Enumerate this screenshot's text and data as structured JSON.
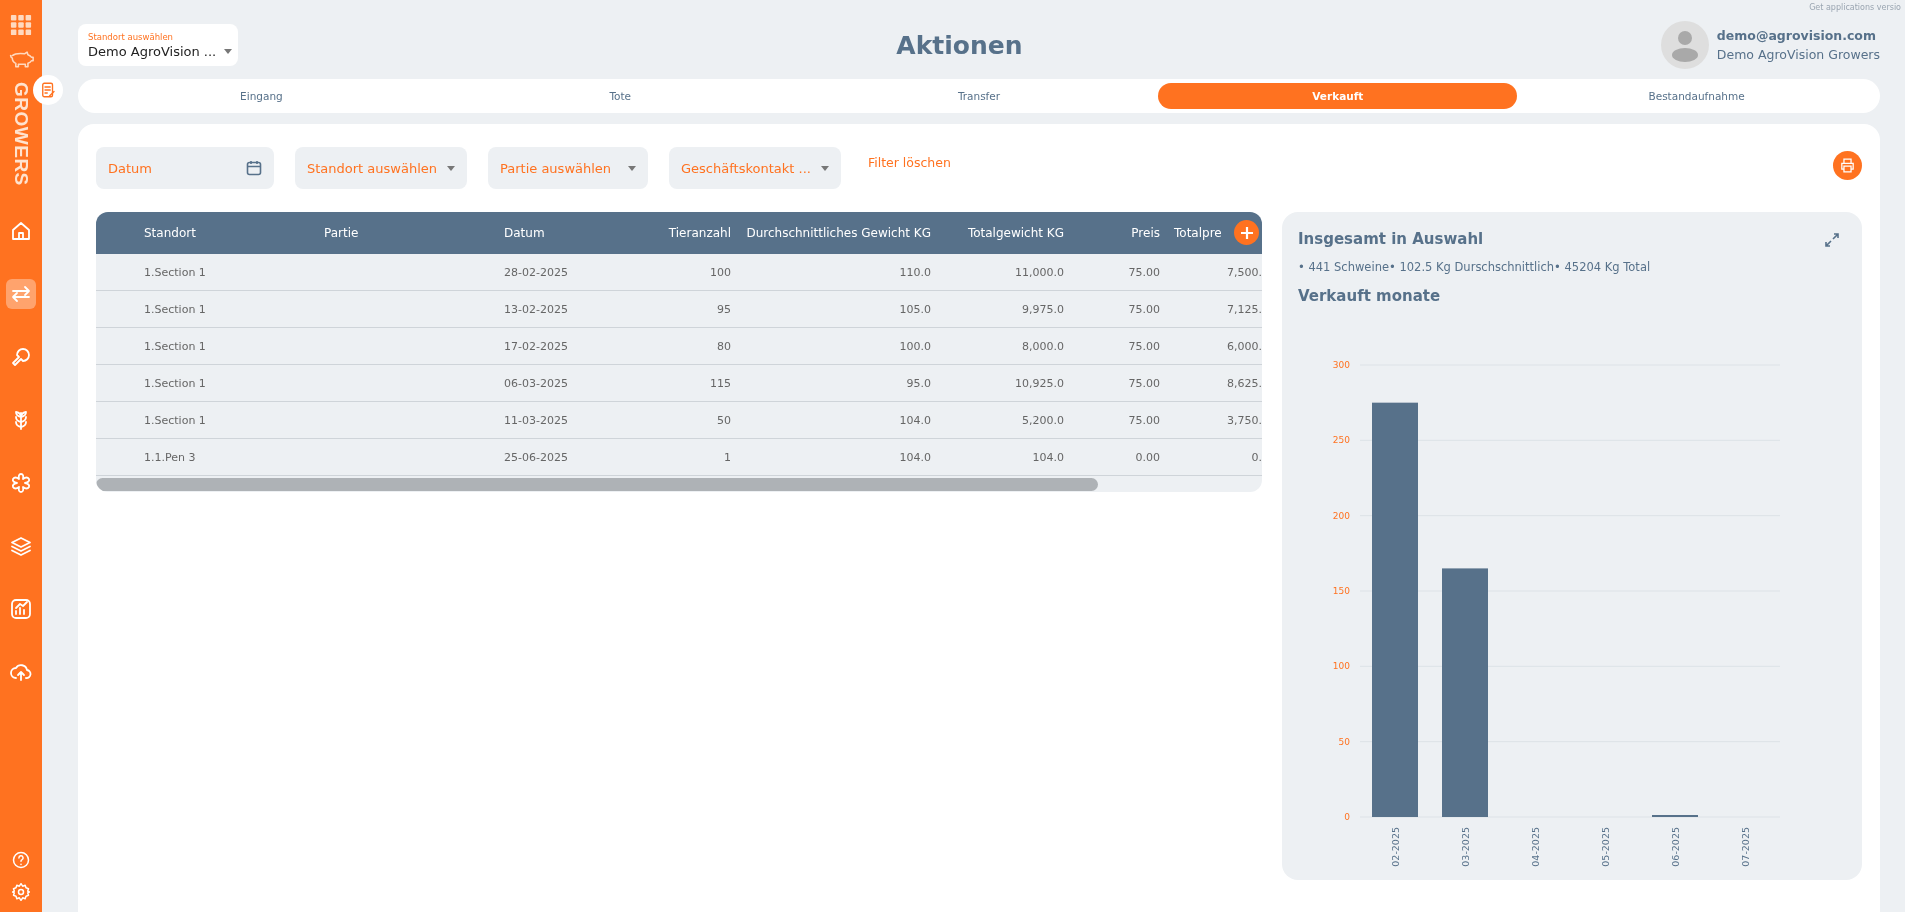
{
  "sidebar": {
    "brand": "GROWERS",
    "items": [
      {
        "selected": false
      },
      {
        "selected": true
      },
      {
        "selected": false
      },
      {
        "selected": false
      },
      {
        "selected": false
      },
      {
        "selected": false
      },
      {
        "selected": false
      },
      {
        "selected": false
      }
    ]
  },
  "location_select": {
    "label": "Standort auswählen",
    "value": "Demo AgroVision ..."
  },
  "page_title": "Aktionen",
  "user": {
    "email": "demo@agrovision.com",
    "company": "Demo AgroVision Growers"
  },
  "version_note": "Get applications versio",
  "tabs": [
    {
      "label": "Eingang",
      "selected": false
    },
    {
      "label": "Tote",
      "selected": false
    },
    {
      "label": "Transfer",
      "selected": false
    },
    {
      "label": "Verkauft",
      "selected": true
    },
    {
      "label": "Bestandaufnahme",
      "selected": false
    }
  ],
  "filters": [
    {
      "kind": "date",
      "label": "Datum"
    },
    {
      "kind": "select",
      "label": "Standort auswählen"
    },
    {
      "kind": "select",
      "label": "Partie auswählen"
    },
    {
      "kind": "select",
      "label": "Geschäftskontakt ..."
    }
  ],
  "clear_filters": "Filter löschen",
  "table": {
    "columns": [
      "Standort",
      "Partie",
      "Datum",
      "Tieranzahl",
      "Durchschnittliches Gewicht KG",
      "Totalgewicht KG",
      "Preis",
      "Totalpre"
    ],
    "rows": [
      [
        "1.Section 1",
        "",
        "28-02-2025",
        "100",
        "110.0",
        "11,000.0",
        "75.00",
        "7,500."
      ],
      [
        "1.Section 1",
        "",
        "13-02-2025",
        "95",
        "105.0",
        "9,975.0",
        "75.00",
        "7,125."
      ],
      [
        "1.Section 1",
        "",
        "17-02-2025",
        "80",
        "100.0",
        "8,000.0",
        "75.00",
        "6,000."
      ],
      [
        "1.Section 1",
        "",
        "06-03-2025",
        "115",
        "95.0",
        "10,925.0",
        "75.00",
        "8,625."
      ],
      [
        "1.Section 1",
        "",
        "11-03-2025",
        "50",
        "104.0",
        "5,200.0",
        "75.00",
        "3,750."
      ],
      [
        "1.1.Pen 3",
        "",
        "25-06-2025",
        "1",
        "104.0",
        "104.0",
        "0.00",
        "0."
      ]
    ]
  },
  "summary": {
    "title": "Insgesamt in Auswahl",
    "stats": "• 441 Schweine• 102.5 Kg Durschschnittlich• 45204 Kg Total",
    "chart_title": "Verkauft monate",
    "chart_data": {
      "type": "bar",
      "categories": [
        "02-2025",
        "03-2025",
        "04-2025",
        "05-2025",
        "06-2025",
        "07-2025"
      ],
      "series": [
        {
          "color": "#57718a",
          "values": [
            275,
            165,
            0,
            0,
            1,
            0
          ]
        }
      ],
      "grid": true,
      "ylim": [
        0,
        300
      ],
      "yticks": [
        0,
        50,
        100,
        150,
        200,
        250,
        300
      ]
    }
  }
}
